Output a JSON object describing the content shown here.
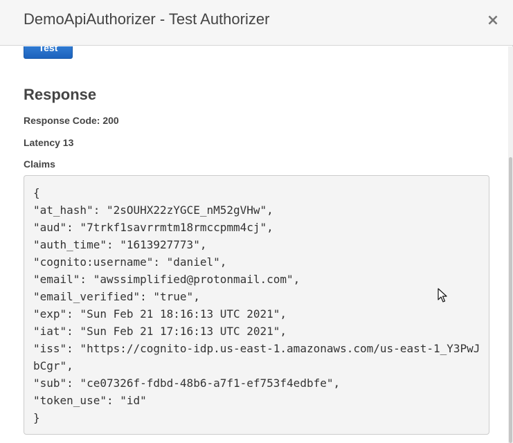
{
  "modal": {
    "title": "DemoApiAuthorizer - Test Authorizer",
    "close_glyph": "×"
  },
  "test_button": {
    "label": "Test"
  },
  "response": {
    "heading": "Response",
    "code_line": "Response Code: 200",
    "latency_line": "Latency 13",
    "claims_label": "Claims",
    "claims_lines": [
      "{",
      "\"at_hash\": \"2sOUHX22zYGCE_nM52gVHw\",",
      "\"aud\": \"7trkf1savrrmtm18rmccpmm4cj\",",
      "\"auth_time\": \"1613927773\",",
      "\"cognito:username\": \"daniel\",",
      "\"email\": \"awssimplified@protonmail.com\",",
      "\"email_verified\": \"true\",",
      "\"exp\": \"Sun Feb 21 18:16:13 UTC 2021\",",
      "\"iat\": \"Sun Feb 21 17:16:13 UTC 2021\",",
      "\"iss\": \"https://cognito-idp.us-east-1.amazonaws.com/us-east-1_Y3PwJ",
      "bCgr\",",
      "\"sub\": \"ce07326f-fdbd-48b6-a7f1-ef753f4edbfe\",",
      "\"token_use\": \"id\"",
      "}"
    ]
  },
  "icons": {
    "close": "close-icon",
    "pointer": "mouse-pointer-icon"
  },
  "colors": {
    "button_blue": "#1c62bd",
    "header_bg": "#f6f6f6",
    "code_bg": "#f4f4f4",
    "text": "#444444"
  }
}
